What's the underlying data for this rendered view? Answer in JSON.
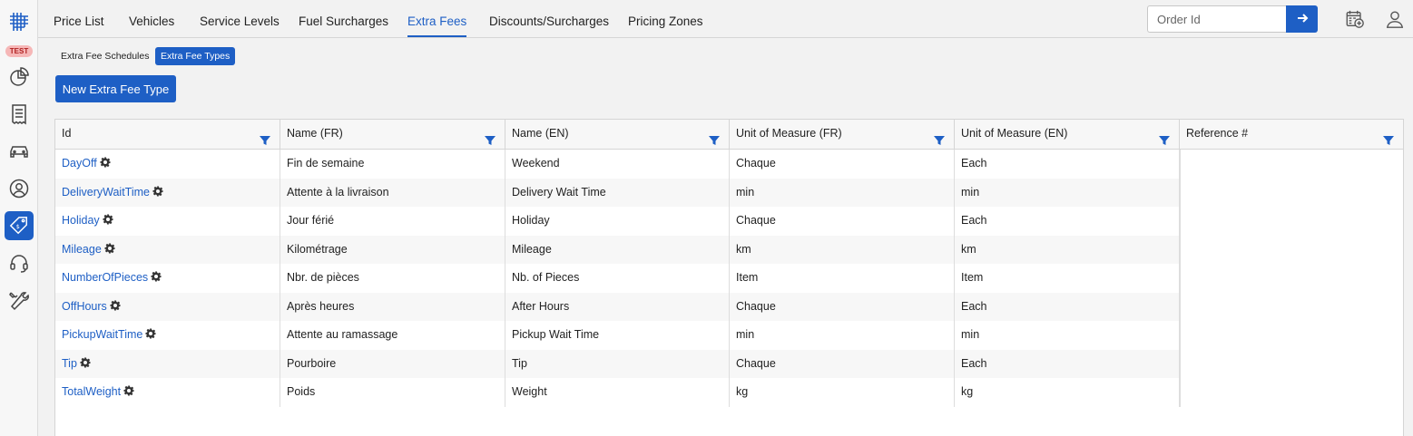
{
  "env_badge": "TEST",
  "tabs": [
    "Price List",
    "Vehicles",
    "Service Levels",
    "Fuel Surcharges",
    "Extra Fees",
    "Discounts/Surcharges",
    "Pricing Zones"
  ],
  "active_tab": "Extra Fees",
  "search": {
    "placeholder": "Order Id",
    "value": ""
  },
  "subtabs": [
    "Extra Fee Schedules",
    "Extra Fee Types"
  ],
  "active_subtab": "Extra Fee Types",
  "new_button_label": "New Extra Fee Type",
  "table": {
    "columns": [
      "Id",
      "Name (FR)",
      "Name (EN)",
      "Unit of Measure (FR)",
      "Unit of Measure (EN)",
      "Reference #"
    ],
    "rows": [
      [
        "DayOff",
        "Fin de semaine",
        "Weekend",
        "Chaque",
        "Each",
        ""
      ],
      [
        "DeliveryWaitTime",
        "Attente à la livraison",
        "Delivery Wait Time",
        "min",
        "min",
        ""
      ],
      [
        "Holiday",
        "Jour férié",
        "Holiday",
        "Chaque",
        "Each",
        ""
      ],
      [
        "Mileage",
        "Kilométrage",
        "Mileage",
        "km",
        "km",
        ""
      ],
      [
        "NumberOfPieces",
        "Nbr. de pièces",
        "Nb. of Pieces",
        "Item",
        "Item",
        ""
      ],
      [
        "OffHours",
        "Après heures",
        "After Hours",
        "Chaque",
        "Each",
        ""
      ],
      [
        "PickupWaitTime",
        "Attente au ramassage",
        "Pickup Wait Time",
        "min",
        "min",
        ""
      ],
      [
        "Tip",
        "Pourboire",
        "Tip",
        "Chaque",
        "Each",
        ""
      ],
      [
        "TotalWeight",
        "Poids",
        "Weight",
        "kg",
        "kg",
        ""
      ]
    ]
  },
  "rail_icons": [
    "logo-icon",
    "dashboard-pie-icon",
    "invoice-icon",
    "vehicle-icon",
    "user-circle-icon",
    "price-tag-icon",
    "support-headset-icon",
    "tools-icon"
  ],
  "active_rail_icon": "price-tag-icon",
  "colors": {
    "accent": "#1e5fc5",
    "badge_bg": "#f6b7b7",
    "badge_text": "#b02020"
  }
}
